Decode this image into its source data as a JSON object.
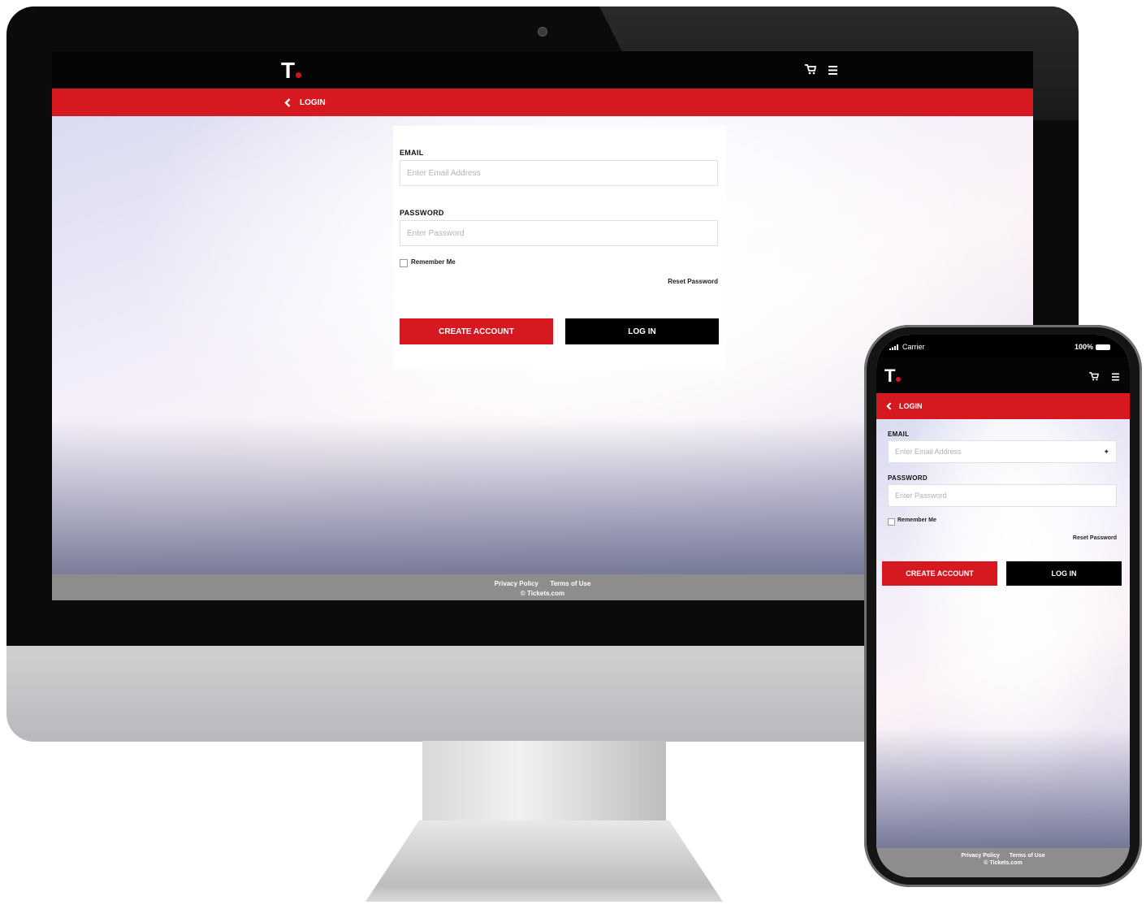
{
  "brand": {
    "logo_letter": "T",
    "accent": "#d61820"
  },
  "header": {
    "cart_icon": "cart-icon",
    "menu_icon": "hamburger-menu-icon"
  },
  "nav": {
    "back_icon": "chevron-left-icon",
    "title": "LOGIN"
  },
  "form": {
    "email_label": "EMAIL",
    "email_placeholder": "Enter Email Address",
    "password_label": "PASSWORD",
    "password_placeholder": "Enter Password",
    "remember_label": "Remember Me",
    "reset_link": "Reset Password",
    "create_account": "CREATE ACCOUNT",
    "log_in": "LOG IN"
  },
  "footer": {
    "privacy": "Privacy Policy",
    "terms": "Terms of Use",
    "copyright": "© Tickets.com"
  },
  "phone_status": {
    "carrier": "Carrier",
    "battery": "100%"
  },
  "colors": {
    "header_bg": "#050505",
    "footer_bg": "#8d8d8d",
    "button_primary": "#d61820",
    "button_secondary": "#000000"
  }
}
